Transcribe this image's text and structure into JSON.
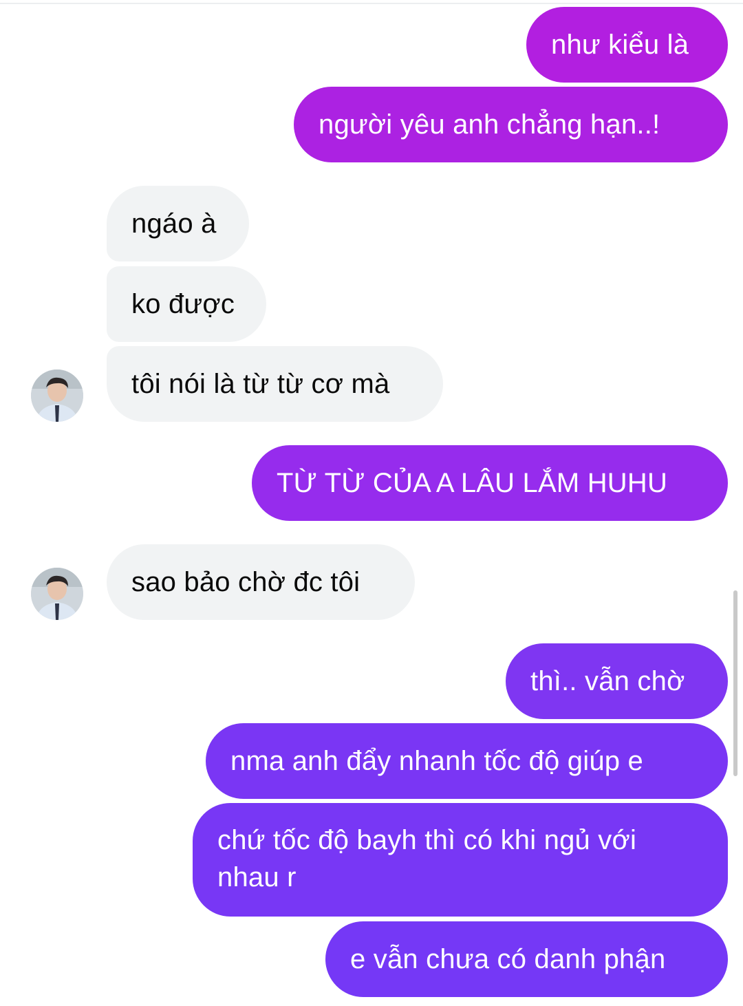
{
  "colors": {
    "outgoing_gradient_top": "#b11ee0",
    "outgoing_gradient_mid": "#8a2ef0",
    "outgoing_gradient_bottom": "#7a35f5",
    "incoming_bg": "#f1f3f4",
    "incoming_text": "#0a0a0a"
  },
  "messages": [
    {
      "side": "out",
      "text": "như kiểu là"
    },
    {
      "side": "out",
      "text": "người yêu anh chẳng hạn..!"
    },
    {
      "side": "in",
      "text": "ngáo à"
    },
    {
      "side": "in",
      "text": "ko được"
    },
    {
      "side": "in",
      "text": "tôi nói là từ từ cơ mà"
    },
    {
      "side": "out",
      "text": "TỪ TỪ CỦA A LÂU LẮM HUHU"
    },
    {
      "side": "in",
      "text": "sao bảo chờ đc tôi"
    },
    {
      "side": "out",
      "text": "thì.. vẫn chờ"
    },
    {
      "side": "out",
      "text": "nma anh đẩy nhanh tốc độ giúp e"
    },
    {
      "side": "out",
      "text": "chứ tốc độ bayh thì có khi ngủ với nhau r"
    },
    {
      "side": "out",
      "text": "e vẫn chưa có danh phận"
    }
  ],
  "avatars": [
    "contact-avatar",
    "contact-avatar"
  ]
}
